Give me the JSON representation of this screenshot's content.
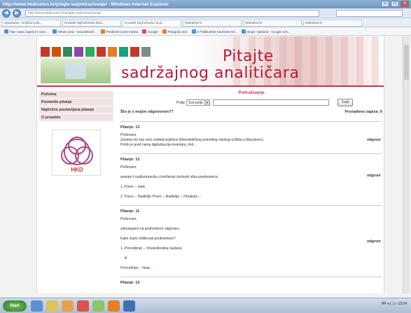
{
  "browser": {
    "title": "http://www.hkdrustvo.hr/pitajte-sa/pretrazivanje/ - Windows Internet Explorer",
    "address": "http://www.hkdrustvo.hr/pitajte-sa/pretrazivanje/",
    "tabs": [
      {
        "label": "Hjacinante - Knjižna trošt..."
      },
      {
        "label": "Hrvatski knjižničarsko druš..."
      },
      {
        "label": "Hrvatski knjižničarsko druš..."
      },
      {
        "label": "Rebratice.hr"
      },
      {
        "label": "Rebratice.hr"
      },
      {
        "label": "Rebratice.hr"
      }
    ],
    "favorites": [
      {
        "label": "http--www.zagreb.hr-User..."
      },
      {
        "label": "What's new - www.bitstuff..."
      },
      {
        "label": "Predloženi web-mjesta"
      },
      {
        "label": "Google"
      },
      {
        "label": "Prilagodi veze"
      },
      {
        "label": "KT-Bibliothek Karlsruhe Kit..."
      },
      {
        "label": "Birger Hjørland - Google Sch..."
      }
    ]
  },
  "site": {
    "title_line1": "Pitajte",
    "title_line2": "sadržajnog analitičara",
    "tile_colors": [
      "#c0392b",
      "#d35400",
      "#2e8b57",
      "#8e44ad",
      "#27ae60",
      "#c0392b",
      "#e67e22",
      "#16a085",
      "#c0392b",
      "#7f8c8d"
    ]
  },
  "sidebar": {
    "items": [
      {
        "label": "Početna"
      },
      {
        "label": "Postavite pitanje"
      },
      {
        "label": "Najčešće postavljana pitanja"
      },
      {
        "label": "O projektu"
      }
    ],
    "logo_text": "HKD"
  },
  "main": {
    "heading": "Pretraživanje",
    "search": {
      "label": "Polje",
      "select_value": "Sva polja",
      "button": "Traži"
    },
    "left_meta": "Što je s mojim odgovorom??",
    "right_meta": "Pronađeno zapisa: 9",
    "questions": [
      {
        "head": "Pitanje: 13",
        "lines": [
          "Poštovani,",
          "Zanima me kao novi voditelj knjižnice Adventističkog teološkog visokog učilišta u Maruševcu.",
          "Pošto je pred nama digitalizacija inventara, želi..."
        ],
        "answer": "odgovor"
      },
      {
        "head": "Pitanje: 12",
        "lines": [
          "Poštovani,",
          "postoje li razlike/pravila u korištenju složenih slika predmetnica:",
          "1. Pravo -- Izjek",
          "2. Pravo -- Nadležje Pravo -- Nadležje -- Hrvatska ..."
        ],
        "answer": "odgovor"
      },
      {
        "head": "Pitanje: 11",
        "lines": [
          "Poštovani,",
          "zahvaljujem na prethodnom odgovoru.",
          "Kako inače oblikovati predmetnice?",
          "1. Prevođenje -- Visokoškolska nastava",
          "ili",
          "Prevođenje -- Nast..."
        ],
        "answer": "odgovor"
      },
      {
        "head": "Pitanje: 10"
      }
    ]
  },
  "taskbar": {
    "start": "Start",
    "tray": "HR  ◂ ▢ ▷  13:24"
  }
}
